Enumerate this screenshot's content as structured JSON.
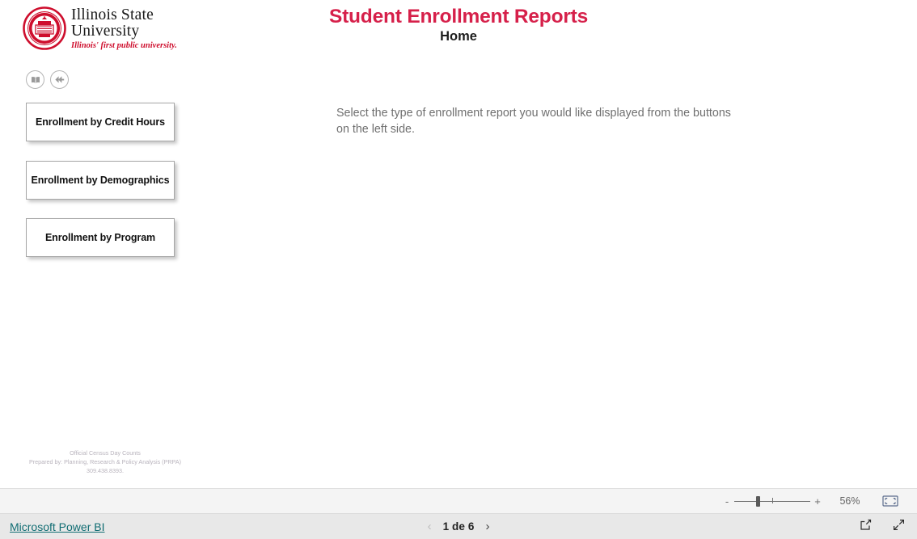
{
  "brand": {
    "seal_alt": "illinois-state-university-seal",
    "line1": "Illinois State",
    "line2": "University",
    "tagline": "Illinois' first public university.",
    "red": "#CE0E2D"
  },
  "header": {
    "title": "Student Enrollment Reports",
    "subtitle": "Home",
    "title_color": "#D6204A"
  },
  "nav_icons": [
    {
      "name": "bookmarks-icon",
      "label": "Bookmarks"
    },
    {
      "name": "back-icon",
      "label": "Back"
    }
  ],
  "report_buttons": [
    {
      "label": "Enrollment by Credit Hours"
    },
    {
      "label": "Enrollment by Demographics"
    },
    {
      "label": "Enrollment by Program"
    }
  ],
  "main": {
    "intro": "Select the type of enrollment report you would like displayed from the buttons on the left side."
  },
  "footnote": {
    "line1": "Official Census Day Counts",
    "line2": "Prepared by: Planning, Research & Policy Analysis (PRPA)",
    "line3": "309.438.8393."
  },
  "zoom_bar": {
    "minus": "-",
    "plus": "+",
    "value": "56%",
    "fit_icon": "fit-to-page-icon"
  },
  "status_bar": {
    "powerbi_label": "Microsoft Power BI",
    "powerbi_color": "#0f6c72",
    "prev_label": "‹",
    "page_label": "1 de 6",
    "next_label": "›",
    "share_icon": "share-icon",
    "fullscreen_icon": "fullscreen-icon"
  }
}
